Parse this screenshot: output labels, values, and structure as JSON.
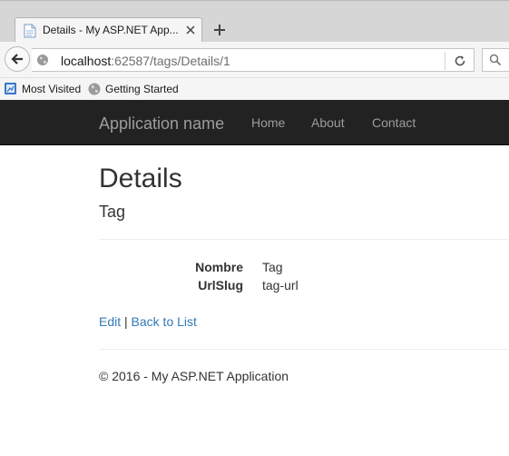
{
  "browser": {
    "tab_title": "Details - My ASP.NET App...",
    "url_host": "localhost",
    "url_rest": ":62587/tags/Details/1",
    "bookmarks": [
      {
        "label": "Most Visited",
        "icon": "most-visited-icon"
      },
      {
        "label": "Getting Started",
        "icon": "globe-icon"
      }
    ]
  },
  "site": {
    "brand": "Application name",
    "nav": [
      "Home",
      "About",
      "Contact"
    ]
  },
  "page": {
    "title": "Details",
    "subtitle": "Tag",
    "fields": [
      {
        "label": "Nombre",
        "value": "Tag"
      },
      {
        "label": "UrlSlug",
        "value": "tag-url"
      }
    ],
    "edit_link": "Edit",
    "separator": "|",
    "back_link": "Back to List",
    "footer": "© 2016 - My ASP.NET Application"
  },
  "colors": {
    "navbar_bg": "#222222",
    "nav_text": "#9d9d9d",
    "link": "#337ab7"
  }
}
